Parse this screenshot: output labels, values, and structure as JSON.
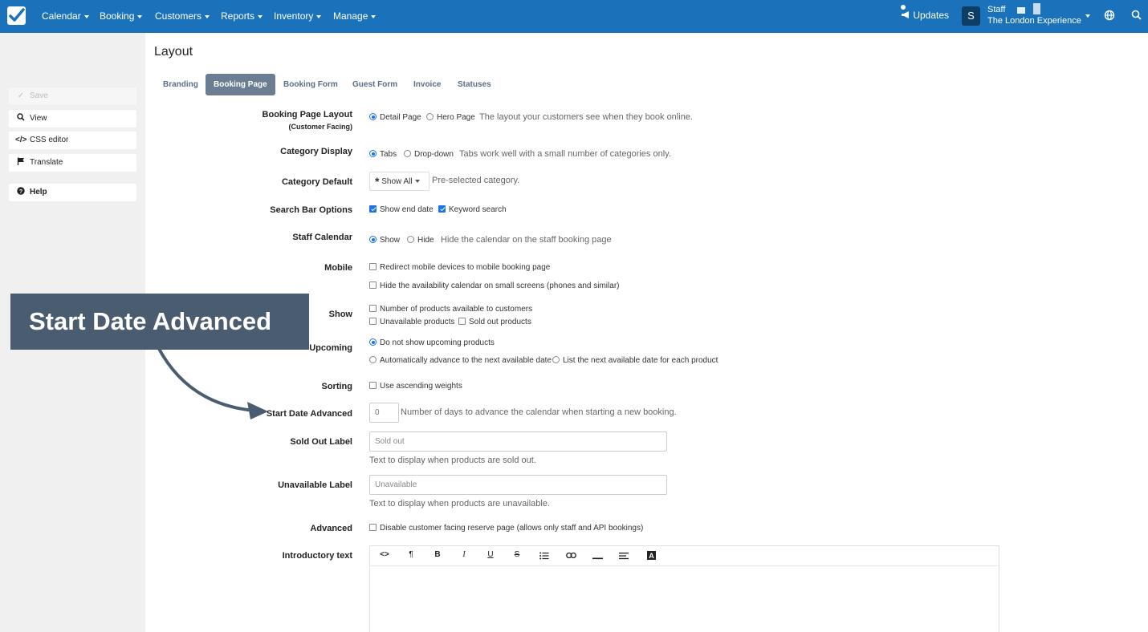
{
  "navbar": {
    "menus": [
      "Calendar",
      "Booking",
      "Customers",
      "Reports",
      "Inventory",
      "Manage"
    ],
    "updates_label": "Updates",
    "avatar_initial": "S",
    "user_role": "Staff",
    "user_org": "The London Experience"
  },
  "sidebar": {
    "save_label": "Save",
    "view_label": "View",
    "css_editor_label": "CSS editor",
    "translate_label": "Translate",
    "help_label": "Help"
  },
  "page": {
    "title": "Layout",
    "tabs": [
      "Branding",
      "Booking Page",
      "Booking Form",
      "Guest Form",
      "Invoice",
      "Statuses"
    ],
    "active_tab": "Booking Page"
  },
  "form": {
    "booking_page_layout": {
      "label": "Booking Page Layout",
      "sublabel": "(Customer Facing)",
      "options": [
        "Detail Page",
        "Hero Page"
      ],
      "selected": "Detail Page",
      "help": "The layout your customers see when they book online."
    },
    "category_display": {
      "label": "Category Display",
      "options": [
        "Tabs",
        "Drop-down"
      ],
      "selected": "Tabs",
      "help": "Tabs work well with a small number of categories only."
    },
    "category_default": {
      "label": "Category Default",
      "value": "Show All",
      "help": "Pre-selected category."
    },
    "search_bar_options": {
      "label": "Search Bar Options",
      "options": [
        "Show end date",
        "Keyword search"
      ]
    },
    "staff_calendar": {
      "label": "Staff Calendar",
      "options": [
        "Show",
        "Hide"
      ],
      "selected": "Show",
      "help": "Hide the calendar on the staff booking page"
    },
    "mobile": {
      "label": "Mobile",
      "options": [
        "Redirect mobile devices to mobile booking page",
        "Hide the availability calendar on small screens (phones and similar)"
      ]
    },
    "show": {
      "label": "Show",
      "options": [
        "Number of products available to customers",
        "Unavailable products",
        "Sold out products"
      ]
    },
    "upcoming": {
      "label": "Upcoming",
      "options": [
        "Do not show upcoming products",
        "Automatically advance to the next available date",
        "List the next available date for each product"
      ],
      "selected": "Do not show upcoming products"
    },
    "sorting": {
      "label": "Sorting",
      "options": [
        "Use ascending weights"
      ]
    },
    "start_date_advanced": {
      "label": "Start Date Advanced",
      "placeholder": "0",
      "help": "Number of days to advance the calendar when starting a new booking."
    },
    "sold_out_label": {
      "label": "Sold Out Label",
      "placeholder": "Sold out",
      "help": "Text to display when products are sold out."
    },
    "unavailable_label": {
      "label": "Unavailable Label",
      "placeholder": "Unavailable",
      "help": "Text to display when products are unavailable."
    },
    "advanced": {
      "label": "Advanced",
      "options": [
        "Disable customer facing reserve page (allows only staff and API bookings)"
      ]
    },
    "introductory_text": {
      "label": "Introductory text",
      "toolbar": [
        "<>",
        "¶",
        "B",
        "I",
        "U",
        "S",
        "list",
        "link",
        "hr",
        "align",
        "A"
      ]
    }
  },
  "annotation": {
    "callout_text": "Start Date Advanced"
  }
}
